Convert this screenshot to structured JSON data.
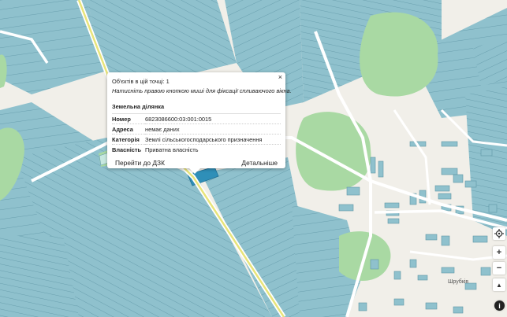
{
  "popup": {
    "close_glyph": "×",
    "objects_count": "Об'єктів в цій точці: 1",
    "hint": "Натисніть правою кнопкою миші для фіксації спливаючого вікна.",
    "heading": "Земельна ділянка",
    "rows": [
      {
        "key": "Номер",
        "value": "6823086600:03:001:0015"
      },
      {
        "key": "Адреса",
        "value": "немає даних"
      },
      {
        "key": "Категорія",
        "value": "Землі сільськогосподарського призначення"
      },
      {
        "key": "Власність",
        "value": "Приватна власність"
      }
    ],
    "goto_dzk_label": "Перейти до ДЗК",
    "details_label": "Детальніше"
  },
  "map": {
    "place_label": "Шрубків",
    "colors": {
      "background": "#f1efe9",
      "parcel": "#8fc1cd",
      "parcel_stroke": "#5f97a6",
      "forest": "#a9d9a3",
      "selected": "#2f8fb8",
      "road_yellow": "#e8e47a"
    }
  },
  "controls": {
    "locate_icon": "locate-icon",
    "zoom_in_label": "+",
    "zoom_out_label": "−",
    "north_label": "▲",
    "info_label": "i"
  }
}
